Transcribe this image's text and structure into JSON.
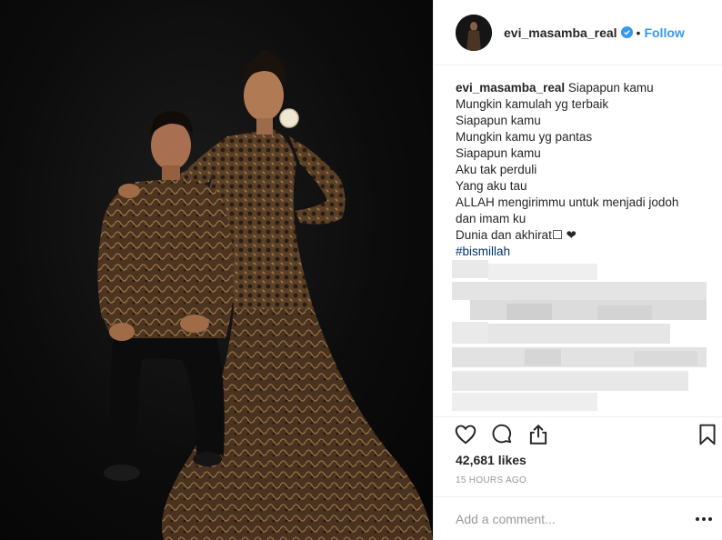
{
  "post": {
    "username": "evi_masamba_real",
    "follow_label": "Follow",
    "separator": "•",
    "caption_user": "evi_masamba_real",
    "caption_lines": [
      "Siapapun kamu",
      "Mungkin kamulah yg terbaik",
      "Siapapun kamu",
      "Mungkin kamu yg pantas",
      "Siapapun kamu",
      "Aku tak perduli",
      "Yang aku tau",
      "ALLAH mengirimmu untuk menjadi jodoh",
      "dan imam ku",
      "Dunia dan akhirat☐ ❤"
    ],
    "hashtag": "#bismillah",
    "likes": "42,681 likes",
    "time_ago": "15 HOURS AGO",
    "comment_placeholder": "Add a comment..."
  },
  "icons": {
    "verified": "verified-badge-icon",
    "like": "heart-icon",
    "comment": "comment-bubble-icon",
    "share": "share-icon",
    "save": "bookmark-icon",
    "more": "more-options-icon"
  },
  "colors": {
    "accent": "#3897f0",
    "hashtag": "#003569",
    "muted": "#999999",
    "text": "#262626",
    "photo_bg": "#0a0a0a"
  }
}
